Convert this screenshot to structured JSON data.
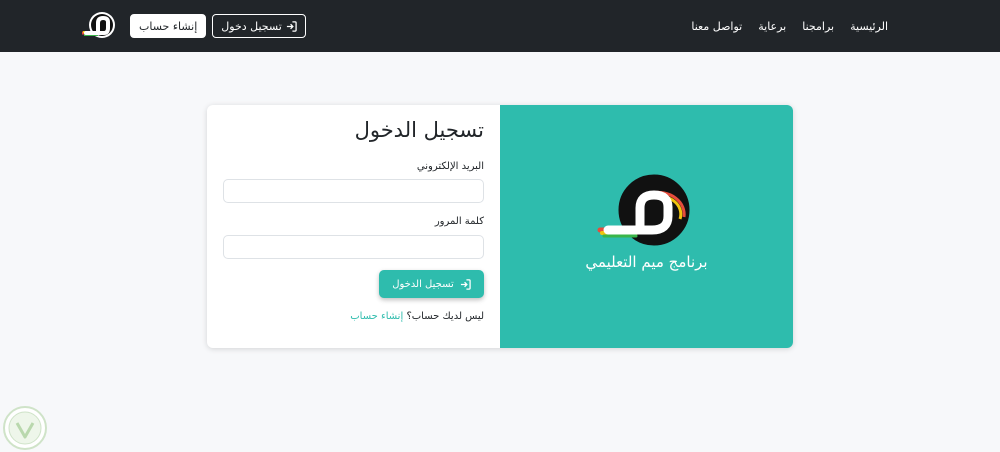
{
  "nav": {
    "links": [
      {
        "label": "الرئيسية"
      },
      {
        "label": "برامجنا"
      },
      {
        "label": "برعاية"
      },
      {
        "label": "تواصل معنا"
      }
    ],
    "login_label": "تسجيل دخول",
    "signup_label": "إنشاء حساب",
    "logo_icon": "meem-logo-icon"
  },
  "login": {
    "title": "تسجيل الدخول",
    "email_label": "البريد الإلكتروني",
    "email_value": "",
    "password_label": "كلمة المرور",
    "password_value": "",
    "submit_label": "تسجيل الدخول",
    "no_account_text": "ليس لديك حساب؟",
    "signup_link": "إنشاء حساب"
  },
  "brand": {
    "name": "برنامج ميم التعليمي"
  },
  "colors": {
    "navbar": "#212529",
    "accent": "#2ebcad",
    "background": "#f7f8fa"
  }
}
